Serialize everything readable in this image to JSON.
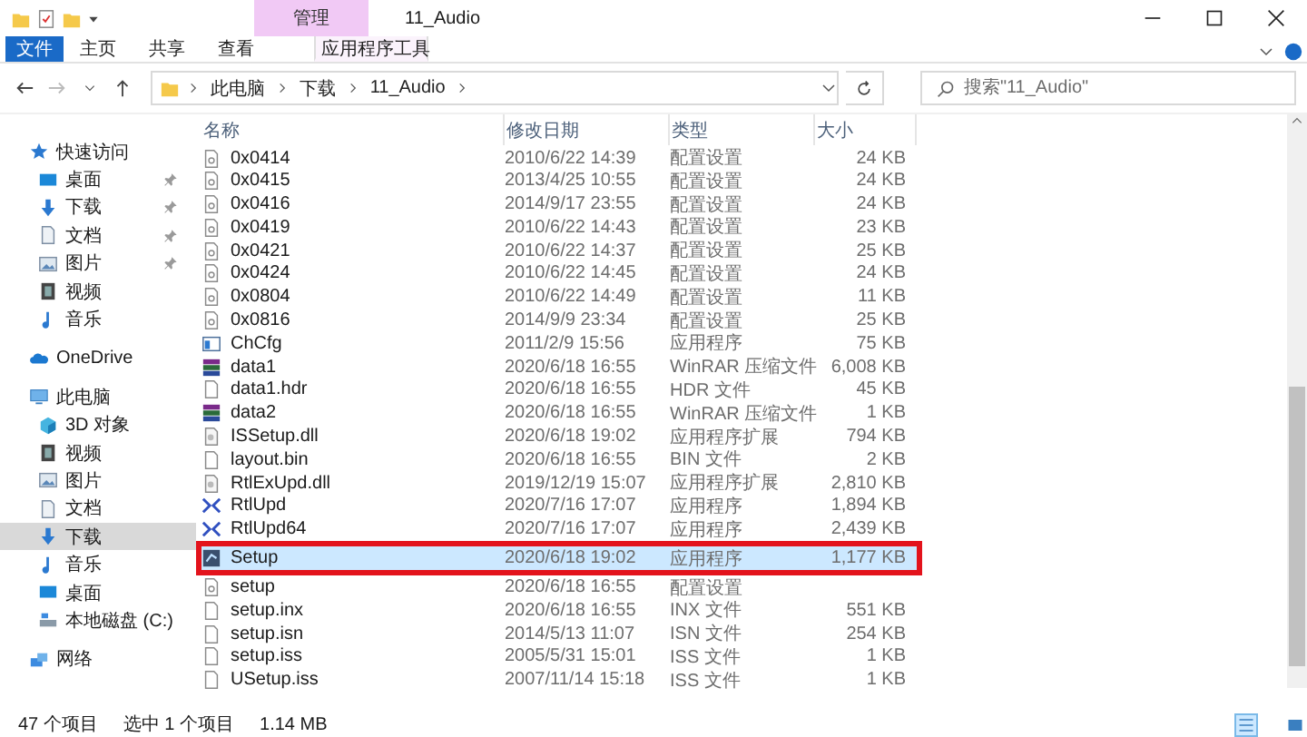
{
  "window": {
    "title": "11_Audio",
    "context_group": "管理"
  },
  "ribbon_tabs": [
    {
      "label": "文件",
      "kind": "file",
      "selected": false
    },
    {
      "label": "主页",
      "kind": "normal",
      "selected": false
    },
    {
      "label": "共享",
      "kind": "normal",
      "selected": false
    },
    {
      "label": "查看",
      "kind": "normal",
      "selected": false
    },
    {
      "label": "应用程序工具",
      "kind": "context",
      "selected": true
    }
  ],
  "address": {
    "crumbs": [
      "此电脑",
      "下载",
      "11_Audio"
    ]
  },
  "search": {
    "placeholder": "搜索\"11_Audio\""
  },
  "sidebar": [
    {
      "label": "快速访问",
      "kind": "star",
      "selected": false,
      "children": [
        {
          "label": "桌面",
          "kind": "desktop",
          "pinned": true,
          "selected": false
        },
        {
          "label": "下载",
          "kind": "download",
          "pinned": true,
          "selected": false
        },
        {
          "label": "文档",
          "kind": "doc",
          "pinned": true,
          "selected": false
        },
        {
          "label": "图片",
          "kind": "picture",
          "pinned": true,
          "selected": false
        },
        {
          "label": "视频",
          "kind": "video",
          "pinned": false,
          "selected": false
        },
        {
          "label": "音乐",
          "kind": "music",
          "pinned": false,
          "selected": false
        }
      ]
    },
    {
      "label": "OneDrive",
      "kind": "cloud",
      "selected": false
    },
    {
      "label": "此电脑",
      "kind": "pc",
      "selected": false,
      "children": [
        {
          "label": "3D 对象",
          "kind": "cube",
          "selected": false
        },
        {
          "label": "视频",
          "kind": "video",
          "selected": false
        },
        {
          "label": "图片",
          "kind": "picture",
          "selected": false
        },
        {
          "label": "文档",
          "kind": "doc",
          "selected": false
        },
        {
          "label": "下载",
          "kind": "download",
          "selected": true
        },
        {
          "label": "音乐",
          "kind": "music",
          "selected": false
        },
        {
          "label": "桌面",
          "kind": "desktop",
          "selected": false
        },
        {
          "label": "本地磁盘 (C:)",
          "kind": "drive",
          "selected": false
        }
      ]
    },
    {
      "label": "网络",
      "kind": "network",
      "selected": false
    }
  ],
  "table": {
    "columns": [
      "名称",
      "修改日期",
      "类型",
      "大小"
    ],
    "rows": [
      {
        "kind": "config",
        "name": "0x0414",
        "date": "2010/6/22 14:39",
        "type": "配置设置",
        "size": "24 KB",
        "selected": false,
        "highlighted": false
      },
      {
        "kind": "config",
        "name": "0x0415",
        "date": "2013/4/25 10:55",
        "type": "配置设置",
        "size": "24 KB",
        "selected": false,
        "highlighted": false
      },
      {
        "kind": "config",
        "name": "0x0416",
        "date": "2014/9/17 23:55",
        "type": "配置设置",
        "size": "24 KB",
        "selected": false,
        "highlighted": false
      },
      {
        "kind": "config",
        "name": "0x0419",
        "date": "2010/6/22 14:43",
        "type": "配置设置",
        "size": "23 KB",
        "selected": false,
        "highlighted": false
      },
      {
        "kind": "config",
        "name": "0x0421",
        "date": "2010/6/22 14:37",
        "type": "配置设置",
        "size": "25 KB",
        "selected": false,
        "highlighted": false
      },
      {
        "kind": "config",
        "name": "0x0424",
        "date": "2010/6/22 14:45",
        "type": "配置设置",
        "size": "24 KB",
        "selected": false,
        "highlighted": false
      },
      {
        "kind": "config",
        "name": "0x0804",
        "date": "2010/6/22 14:49",
        "type": "配置设置",
        "size": "11 KB",
        "selected": false,
        "highlighted": false
      },
      {
        "kind": "config",
        "name": "0x0816",
        "date": "2014/9/9 23:34",
        "type": "配置设置",
        "size": "25 KB",
        "selected": false,
        "highlighted": false
      },
      {
        "kind": "app",
        "name": "ChCfg",
        "date": "2011/2/9 15:56",
        "type": "应用程序",
        "size": "75 KB",
        "selected": false,
        "highlighted": false
      },
      {
        "kind": "archive",
        "name": "data1",
        "date": "2020/6/18 16:55",
        "type": "WinRAR 压缩文件",
        "size": "6,008 KB",
        "selected": false,
        "highlighted": false
      },
      {
        "kind": "file",
        "name": "data1.hdr",
        "date": "2020/6/18 16:55",
        "type": "HDR 文件",
        "size": "45 KB",
        "selected": false,
        "highlighted": false
      },
      {
        "kind": "archive",
        "name": "data2",
        "date": "2020/6/18 16:55",
        "type": "WinRAR 压缩文件",
        "size": "1 KB",
        "selected": false,
        "highlighted": false
      },
      {
        "kind": "dll",
        "name": "ISSetup.dll",
        "date": "2020/6/18 19:02",
        "type": "应用程序扩展",
        "size": "794 KB",
        "selected": false,
        "highlighted": false
      },
      {
        "kind": "file",
        "name": "layout.bin",
        "date": "2020/6/18 16:55",
        "type": "BIN 文件",
        "size": "2 KB",
        "selected": false,
        "highlighted": false
      },
      {
        "kind": "dll",
        "name": "RtlExUpd.dll",
        "date": "2019/12/19 15:07",
        "type": "应用程序扩展",
        "size": "2,810 KB",
        "selected": false,
        "highlighted": false
      },
      {
        "kind": "tool",
        "name": "RtlUpd",
        "date": "2020/7/16 17:07",
        "type": "应用程序",
        "size": "1,894 KB",
        "selected": false,
        "highlighted": false
      },
      {
        "kind": "tool",
        "name": "RtlUpd64",
        "date": "2020/7/16 17:07",
        "type": "应用程序",
        "size": "2,439 KB",
        "selected": false,
        "highlighted": false
      },
      {
        "kind": "setup",
        "name": "Setup",
        "date": "2020/6/18 19:02",
        "type": "应用程序",
        "size": "1,177 KB",
        "selected": true,
        "highlighted": true
      },
      {
        "kind": "config",
        "name": "setup",
        "date": "2020/6/18 16:55",
        "type": "配置设置",
        "selected": false,
        "highlighted": false
      },
      {
        "kind": "file",
        "name": "setup.inx",
        "date": "2020/6/18 16:55",
        "type": "INX 文件",
        "size": "551 KB",
        "selected": false,
        "highlighted": false
      },
      {
        "kind": "file",
        "name": "setup.isn",
        "date": "2014/5/13 11:07",
        "type": "ISN 文件",
        "size": "254 KB",
        "selected": false,
        "highlighted": false
      },
      {
        "kind": "file",
        "name": "setup.iss",
        "date": "2005/5/31 15:01",
        "type": "ISS 文件",
        "size": "1 KB",
        "selected": false,
        "highlighted": false
      },
      {
        "kind": "file",
        "name": "USetup.iss",
        "date": "2007/11/14 15:18",
        "type": "ISS 文件",
        "size": "1 KB",
        "selected": false,
        "highlighted": false
      }
    ]
  },
  "status_bar": {
    "count": "47 个项目",
    "selection": "选中 1 个项目",
    "size": "1.14 MB"
  },
  "view_buttons": [
    {
      "kind": "details",
      "selected": true
    },
    {
      "kind": "tiles",
      "selected": false
    }
  ]
}
